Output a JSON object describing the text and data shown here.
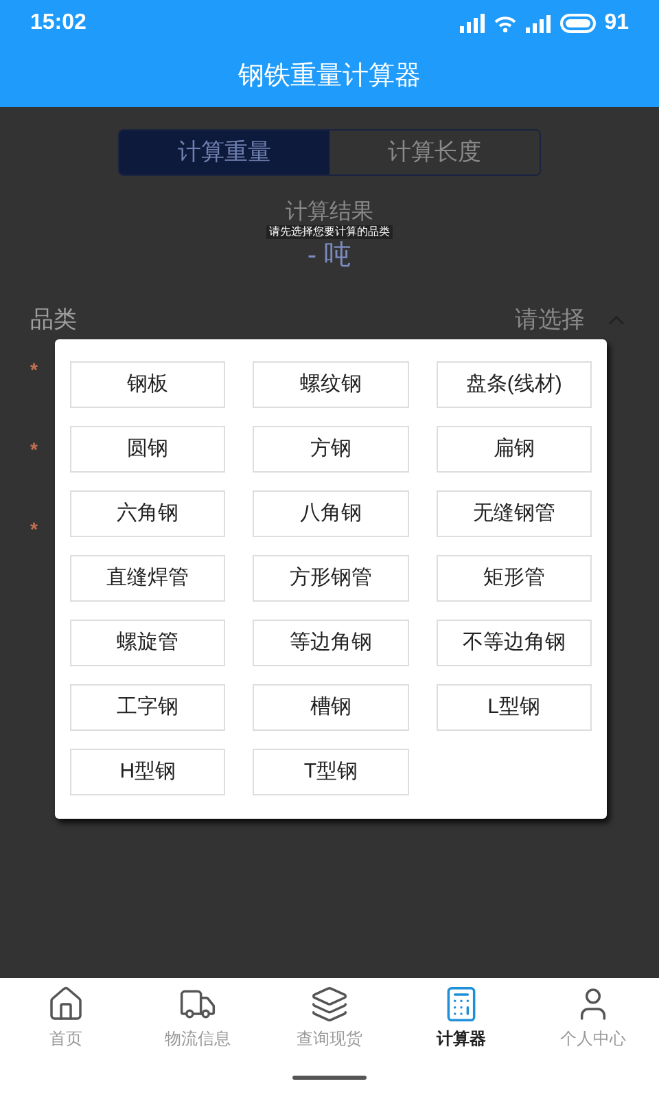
{
  "status_bar": {
    "time": "15:02",
    "battery": "91"
  },
  "header": {
    "title": "钢铁重量计算器"
  },
  "tabs": [
    {
      "label": "计算重量",
      "selected": true
    },
    {
      "label": "计算长度",
      "selected": false
    }
  ],
  "result": {
    "label": "计算结果",
    "value": "- 吨"
  },
  "toast": "请先选择您要计算的品类",
  "category": {
    "label": "品类",
    "value": "请选择",
    "expanded": true
  },
  "required_marks": [
    "*",
    "*",
    "*"
  ],
  "dialog": {
    "options": [
      "钢板",
      "螺纹钢",
      "盘条(线材)",
      "圆钢",
      "方钢",
      "扁钢",
      "六角钢",
      "八角钢",
      "无缝钢管",
      "直缝焊管",
      "方形钢管",
      "矩形管",
      "螺旋管",
      "等边角钢",
      "不等边角钢",
      "工字钢",
      "槽钢",
      "L型钢",
      "H型钢",
      "T型钢"
    ]
  },
  "nav": [
    {
      "label": "首页",
      "kind": "home",
      "selected": false
    },
    {
      "label": "物流信息",
      "kind": "truck",
      "selected": false
    },
    {
      "label": "查询现货",
      "kind": "stock",
      "selected": false
    },
    {
      "label": "计算器",
      "kind": "calculator",
      "selected": true
    },
    {
      "label": "个人中心",
      "kind": "user",
      "selected": false
    }
  ]
}
